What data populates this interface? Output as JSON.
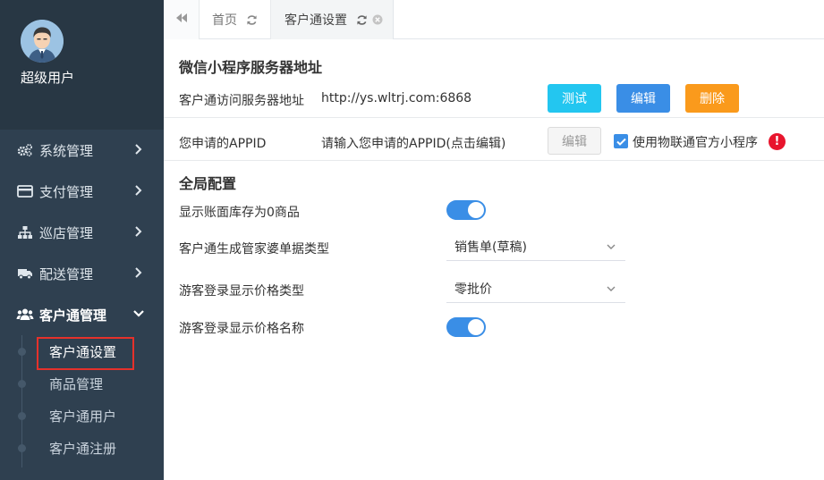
{
  "sidebar": {
    "user": {
      "name": "超级用户",
      "avatar_icon": "user-avatar-icon"
    },
    "menu": [
      {
        "label": "系统管理",
        "icon": "cogs-icon"
      },
      {
        "label": "支付管理",
        "icon": "credit-card-icon"
      },
      {
        "label": "巡店管理",
        "icon": "sitemap-icon"
      },
      {
        "label": "配送管理",
        "icon": "truck-icon"
      },
      {
        "label": "客户通管理",
        "icon": "users-icon"
      }
    ],
    "submenu": [
      {
        "label": "客户通设置"
      },
      {
        "label": "商品管理"
      },
      {
        "label": "客户通用户"
      },
      {
        "label": "客户通注册"
      }
    ]
  },
  "tabs": [
    {
      "label": "首页"
    },
    {
      "label": "客户通设置"
    }
  ],
  "server_section": {
    "title": "微信小程序服务器地址",
    "url_label": "客户通访问服务器地址",
    "url_value": "http://ys.wltrj.com:6868",
    "test_label": "测试",
    "edit_label": "编辑",
    "delete_label": "删除",
    "appid_label": "您申请的APPID",
    "appid_value": "请输入您申请的APPID(点击编辑)",
    "appid_edit_label": "编辑",
    "official_checkbox_label": "使用物联通官方小程序",
    "warning_glyph": "!"
  },
  "global_section": {
    "title": "全局配置",
    "show_zero_stock_label": "显示账面库存为0商品",
    "doc_type_label": "客户通生成管家婆单据类型",
    "doc_type_value": "销售单(草稿)",
    "guest_price_type_label": "游客登录显示价格类型",
    "guest_price_type_value": "零批价",
    "guest_price_name_label": "游客登录显示价格名称"
  },
  "colors": {
    "sidebar_bg": "#2f4050",
    "primary": "#3a8ee6",
    "info": "#23c6f0",
    "warning": "#fa9a1c",
    "danger": "#e8152d",
    "highlight_box": "#e5312b"
  }
}
